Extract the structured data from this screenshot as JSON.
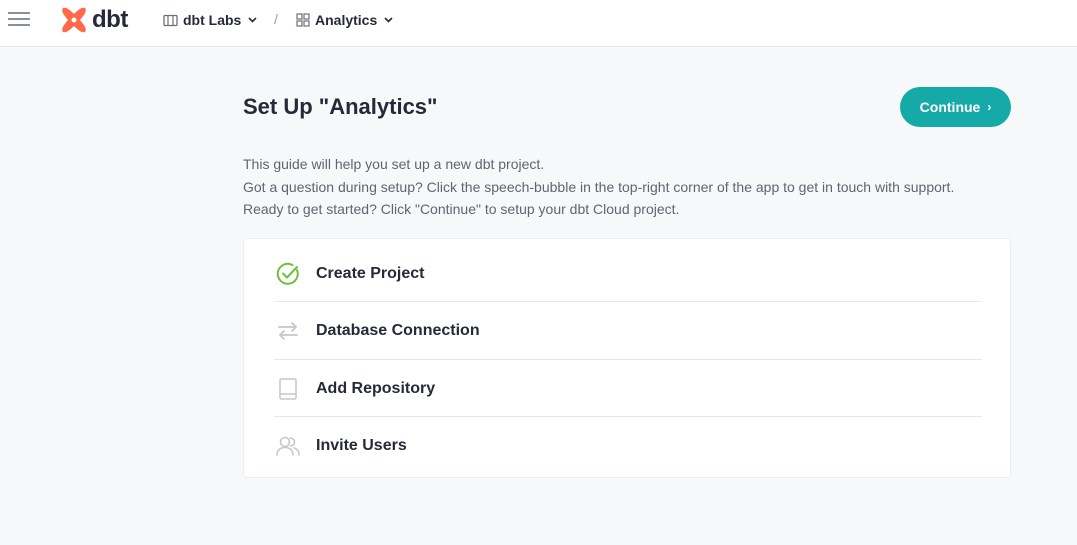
{
  "app": {
    "logo_text": "dbt"
  },
  "breadcrumb": {
    "account": "dbt Labs",
    "separator": "/",
    "project": "Analytics"
  },
  "page": {
    "title": "Set Up \"Analytics\"",
    "continue_label": "Continue",
    "guide_lines": [
      "This guide will help you set up a new dbt project.",
      "Got a question during setup? Click the speech-bubble in the top-right corner of the app to get in touch with support.",
      "Ready to get started? Click \"Continue\" to setup your dbt Cloud project."
    ]
  },
  "steps": [
    {
      "label": "Create Project",
      "icon": "check-circle-icon",
      "status": "complete"
    },
    {
      "label": "Database Connection",
      "icon": "swap-arrows-icon",
      "status": "pending"
    },
    {
      "label": "Add Repository",
      "icon": "book-icon",
      "status": "pending"
    },
    {
      "label": "Invite Users",
      "icon": "users-icon",
      "status": "pending"
    }
  ],
  "colors": {
    "accent": "#15aaa8",
    "brand": "#ff694a",
    "complete": "#6fbf3b",
    "pending_icon": "#c4c8ce"
  }
}
